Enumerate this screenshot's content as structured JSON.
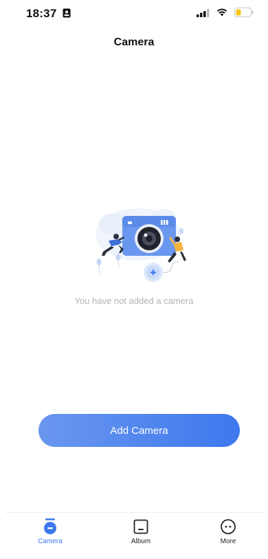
{
  "status_bar": {
    "time": "18:37"
  },
  "header": {
    "title": "Camera"
  },
  "empty_state": {
    "message": "You have not added a camera",
    "illustration": "camera-empty-illustration"
  },
  "actions": {
    "add_camera_label": "Add Camera"
  },
  "tab_bar": {
    "tabs": [
      {
        "label": "Camera",
        "icon": "camera-tab-icon",
        "active": true
      },
      {
        "label": "Album",
        "icon": "album-icon",
        "active": false
      },
      {
        "label": "More",
        "icon": "more-icon",
        "active": false
      }
    ]
  },
  "colors": {
    "accent": "#3d78ee",
    "accent_light": "#6a97ef",
    "muted_text": "#b3b3b3",
    "battery": "#f5c518"
  }
}
